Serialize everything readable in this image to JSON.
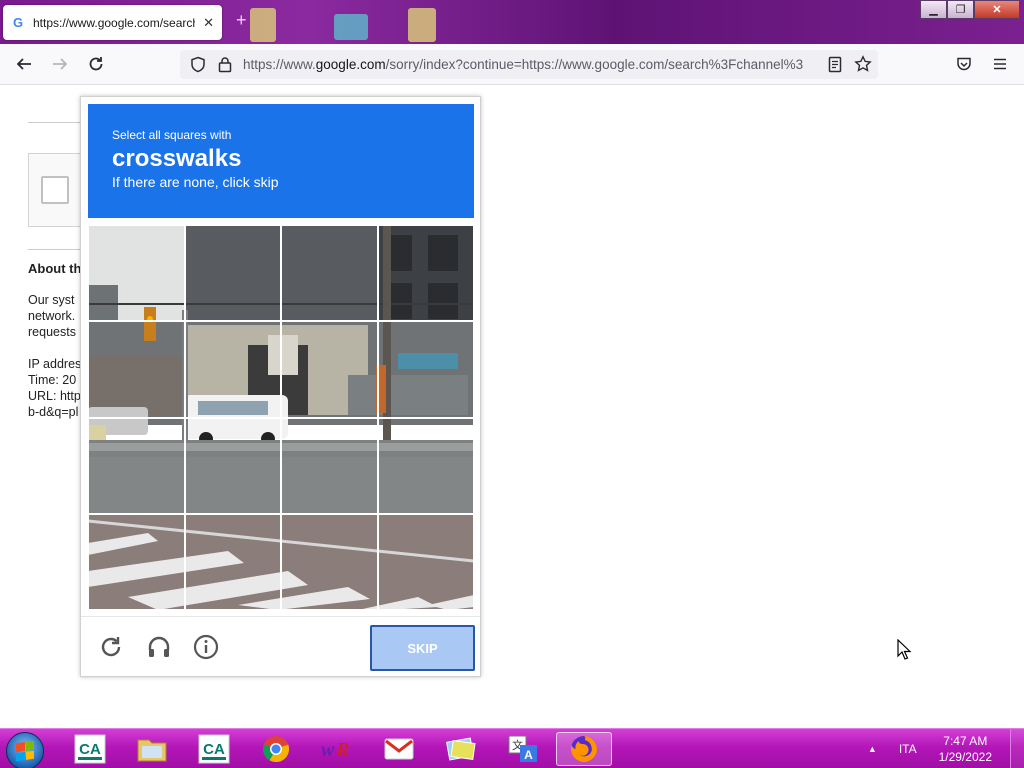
{
  "browser": {
    "tab": {
      "title": "https://www.google.com/search",
      "favicon": "G",
      "close_glyph": "✕"
    },
    "new_tab_glyph": "+",
    "window_controls": {
      "minimize": "▁",
      "restore": "❐",
      "close": "✕"
    },
    "url": {
      "prefix": "https://www.",
      "host": "google.com",
      "rest": "/sorry/index?continue=https://www.google.com/search%3Fchannel%3"
    }
  },
  "page_behind": {
    "about_heading": "About th",
    "para": [
      "Our syst",
      "network.",
      "requests"
    ],
    "meta": [
      "IP addres",
      "Time: 20",
      "URL: http",
      "b-d&q=pl"
    ]
  },
  "captcha": {
    "instruction": "Select all squares with",
    "target": "crosswalks",
    "hint": "If there are none, click skip",
    "grid": {
      "rows": 4,
      "cols": 4
    },
    "skip_label": "SKIP",
    "header_color": "#1a73e8"
  },
  "taskbar": {
    "apps": [
      "credit-agricole-app",
      "file-explorer",
      "credit-agricole-app",
      "chrome",
      "winrar",
      "gmail",
      "photo-viewer",
      "translator",
      "firefox"
    ],
    "language": "ITA",
    "time": "7:47 AM",
    "date": "1/29/2022",
    "tray_arrow": "▲"
  }
}
